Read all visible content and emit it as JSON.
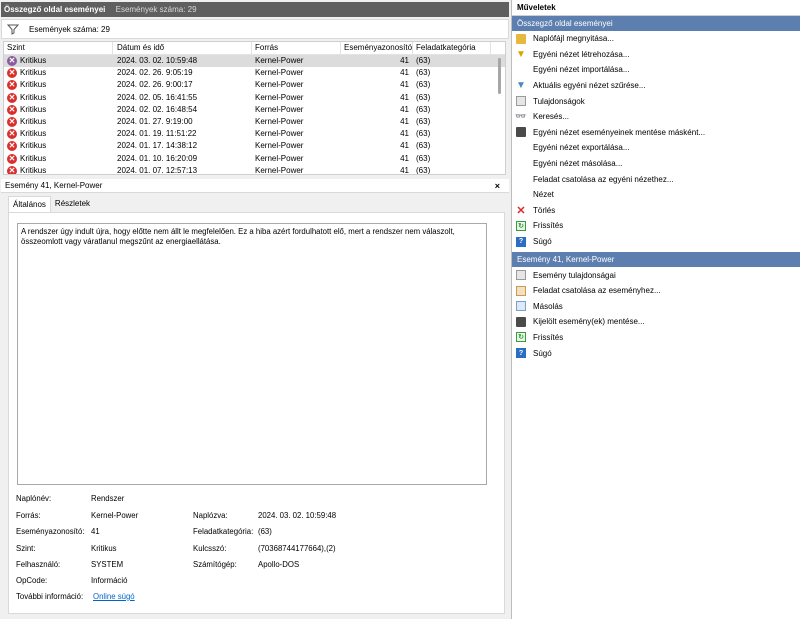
{
  "header": {
    "title": "Összegző oldal eseményei",
    "count": "Események száma: 29"
  },
  "filterbar": {
    "count": "Események száma: 29"
  },
  "table": {
    "columns": [
      "Szint",
      "Dátum és idő",
      "Forrás",
      "Eseményazonosító",
      "Feladatkategória"
    ],
    "rows": [
      {
        "level": "Kritikus",
        "date": "2024. 03. 02. 10:59:48",
        "source": "Kernel-Power",
        "id": "41",
        "cat": "(63)"
      },
      {
        "level": "Kritikus",
        "date": "2024. 02. 26. 9:05:19",
        "source": "Kernel-Power",
        "id": "41",
        "cat": "(63)"
      },
      {
        "level": "Kritikus",
        "date": "2024. 02. 26. 9:00:17",
        "source": "Kernel-Power",
        "id": "41",
        "cat": "(63)"
      },
      {
        "level": "Kritikus",
        "date": "2024. 02. 05. 16:41:55",
        "source": "Kernel-Power",
        "id": "41",
        "cat": "(63)"
      },
      {
        "level": "Kritikus",
        "date": "2024. 02. 02. 16:48:54",
        "source": "Kernel-Power",
        "id": "41",
        "cat": "(63)"
      },
      {
        "level": "Kritikus",
        "date": "2024. 01. 27. 9:19:00",
        "source": "Kernel-Power",
        "id": "41",
        "cat": "(63)"
      },
      {
        "level": "Kritikus",
        "date": "2024. 01. 19. 11:51:22",
        "source": "Kernel-Power",
        "id": "41",
        "cat": "(63)"
      },
      {
        "level": "Kritikus",
        "date": "2024. 01. 17. 14:38:12",
        "source": "Kernel-Power",
        "id": "41",
        "cat": "(63)"
      },
      {
        "level": "Kritikus",
        "date": "2024. 01. 10. 16:20:09",
        "source": "Kernel-Power",
        "id": "41",
        "cat": "(63)"
      },
      {
        "level": "Kritikus",
        "date": "2024. 01. 07. 12:57:13",
        "source": "Kernel-Power",
        "id": "41",
        "cat": "(63)"
      }
    ]
  },
  "detail": {
    "title": "Esemény 41, Kernel-Power",
    "close": "×",
    "tabs": [
      "Általános",
      "Részletek"
    ],
    "description": "A rendszer úgy indult újra, hogy előtte nem állt le megfelelően. Ez a hiba azért fordulhatott elő, mert a rendszer nem válaszolt, összeomlott vagy váratlanul megszűnt az energiaellátása.",
    "fields": {
      "log_label": "Naplónév:",
      "log_value": "Rendszer",
      "source_label": "Forrás:",
      "source_value": "Kernel-Power",
      "logged_label": "Naplózva:",
      "logged_value": "2024. 03. 02. 10:59:48",
      "eventid_label": "Eseményazonosító:",
      "eventid_value": "41",
      "taskcat_label": "Feladatkategória:",
      "taskcat_value": "(63)",
      "level_label": "Szint:",
      "level_value": "Kritikus",
      "keywords_label": "Kulcsszó:",
      "keywords_value": "(70368744177664),(2)",
      "user_label": "Felhasználó:",
      "user_value": "SYSTEM",
      "computer_label": "Számítógép:",
      "computer_value": "Apollo-DOS",
      "opcode_label": "OpCode:",
      "opcode_value": "Információ",
      "moreinfo_label": "További információ:",
      "moreinfo_link": "Online súgó"
    }
  },
  "actions": {
    "title": "Műveletek",
    "section1": {
      "title": "Összegző oldal eseményei",
      "items": [
        {
          "label": "Naplófájl megnyitása...",
          "icon": "folder-open-icon"
        },
        {
          "label": "Egyéni nézet létrehozása...",
          "icon": "filter-icon"
        },
        {
          "label": "Egyéni nézet importálása...",
          "icon": ""
        },
        {
          "label": "Aktuális egyéni nézet szűrése...",
          "icon": "filter-icon"
        },
        {
          "label": "Tulajdonságok",
          "icon": "properties-icon"
        },
        {
          "label": "Keresés...",
          "icon": "binoculars-icon"
        },
        {
          "label": "Egyéni nézet eseményeinek mentése másként...",
          "icon": "save-icon"
        },
        {
          "label": "Egyéni nézet exportálása...",
          "icon": ""
        },
        {
          "label": "Egyéni nézet másolása...",
          "icon": ""
        },
        {
          "label": "Feladat csatolása az egyéni nézethez...",
          "icon": ""
        },
        {
          "label": "Nézet",
          "icon": ""
        },
        {
          "label": "Törlés",
          "icon": "delete-icon"
        },
        {
          "label": "Frissítés",
          "icon": "refresh-icon"
        },
        {
          "label": "Súgó",
          "icon": "help-icon"
        }
      ]
    },
    "section2": {
      "title": "Esemény 41, Kernel-Power",
      "items": [
        {
          "label": "Esemény tulajdonságai",
          "icon": "properties-icon"
        },
        {
          "label": "Feladat csatolása az eseményhez...",
          "icon": "attach-task-icon"
        },
        {
          "label": "Másolás",
          "icon": "copy-icon"
        },
        {
          "label": "Kijelölt esemény(ek) mentése...",
          "icon": "save-icon"
        },
        {
          "label": "Frissítés",
          "icon": "refresh-icon"
        },
        {
          "label": "Súgó",
          "icon": "help-icon"
        }
      ]
    }
  }
}
